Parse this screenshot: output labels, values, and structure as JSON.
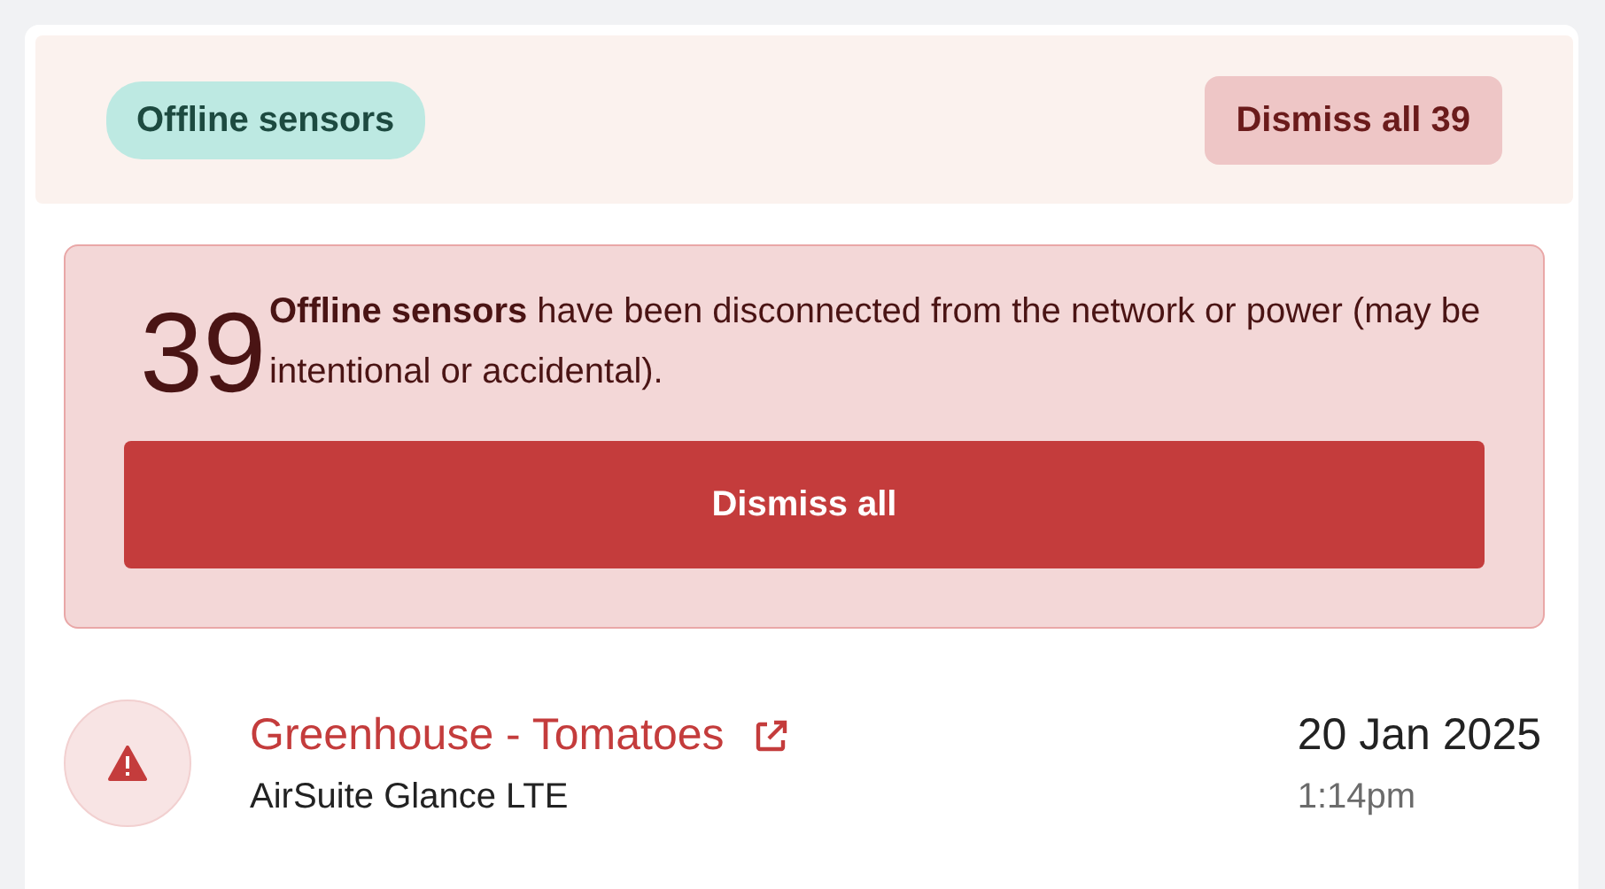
{
  "header": {
    "badge": "Offline sensors",
    "dismiss_button": "Dismiss all 39"
  },
  "alert": {
    "count": "39",
    "message": "**Offline sensors** have been disconnected from the network or power (may be intentional or accidental).",
    "button": "Dismiss all"
  },
  "sensors": [
    {
      "kind": "warning",
      "name": "Greenhouse - Tomatoes",
      "device": "AirSuite Glance LTE",
      "date": "20 Jan 2025",
      "time": "1:14pm"
    }
  ]
}
